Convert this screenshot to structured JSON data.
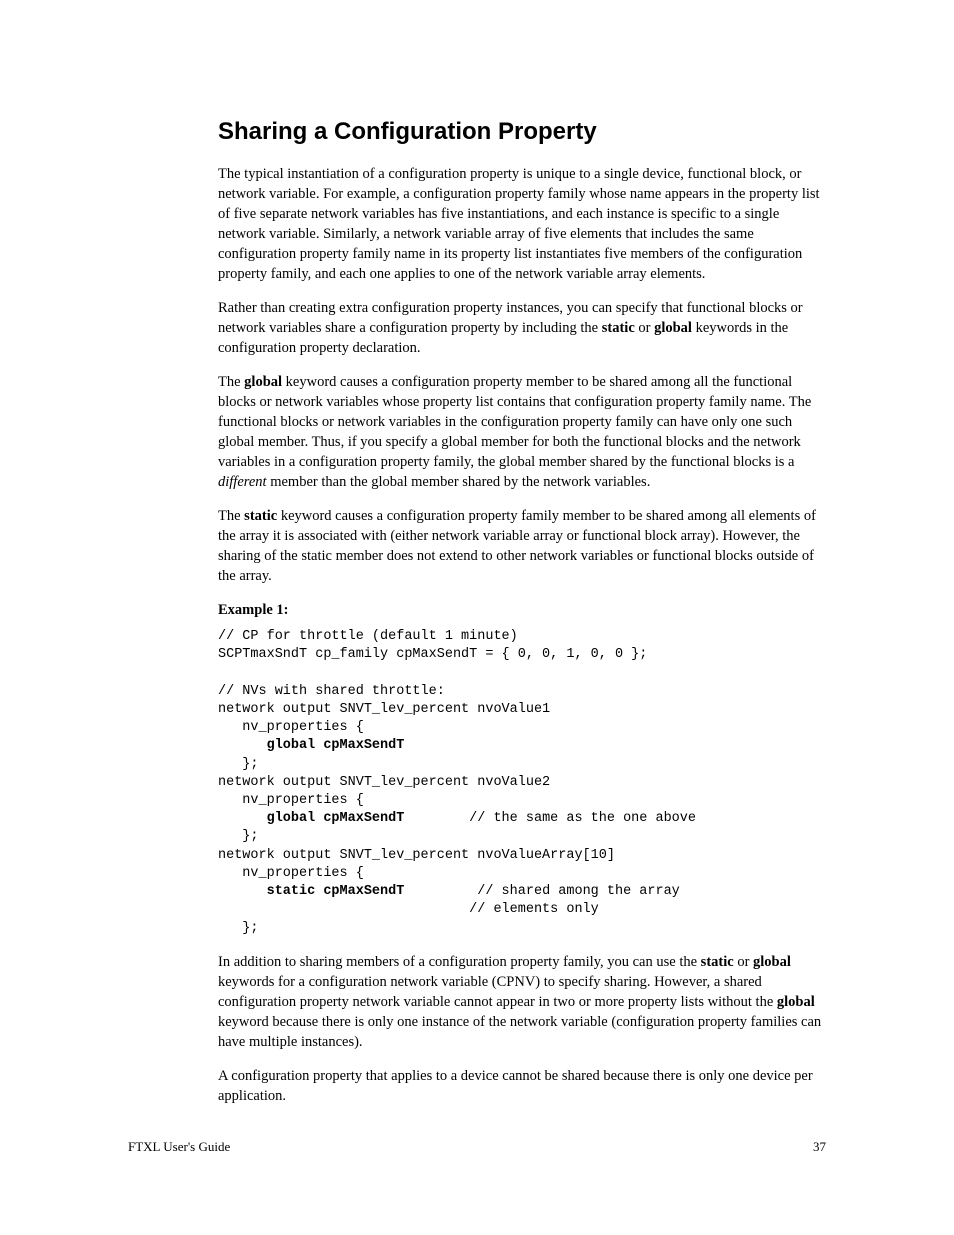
{
  "heading": "Sharing a Configuration Property",
  "para1": "The typical instantiation of a configuration property is unique to a single device, functional block, or network variable.  For example, a configuration property family whose name appears in the property list of five separate network variables has five instantiations, and each instance is specific to a single network variable.  Similarly, a network variable array of five elements that includes the same configuration property family name in its property list instantiates five members of the configuration property family, and each one applies to one of the network variable array elements.",
  "para2_a": "Rather than creating extra configuration property instances, you can specify that functional blocks or network variables share a configuration property by including the ",
  "para2_kw1": "static",
  "para2_b": " or ",
  "para2_kw2": "global",
  "para2_c": " keywords in the configuration property declaration.",
  "para3_a": "The ",
  "para3_kw1": "global",
  "para3_b": " keyword causes a configuration property member to be shared among all the functional blocks or network variables whose property list contains that configuration property family name.  The functional blocks or network variables in the configuration property family can have only one such global member.  Thus, if you specify a global member for both the functional blocks and the network variables in a configuration property family, the global member shared by the functional blocks is a ",
  "para3_italic": "different",
  "para3_c": " member than the global member shared by the network variables.",
  "para4_a": "The ",
  "para4_kw1": "static",
  "para4_b": " keyword causes a configuration property family member to be shared among all elements of the array it is associated with (either network variable array or functional block array).  However, the sharing of the static member does not extend to other network variables or functional blocks outside of the array.",
  "example_label": "Example 1",
  "code": {
    "l1": "// CP for throttle (default 1 minute)",
    "l2": "SCPTmaxSndT cp_family cpMaxSendT = { 0, 0, 1, 0, 0 };",
    "l3": "",
    "l4": "// NVs with shared throttle:",
    "l5": "network output SNVT_lev_percent nvoValue1",
    "l6": "   nv_properties {",
    "l7a": "      ",
    "l7b": "global cpMaxSendT",
    "l8": "   };",
    "l9": "network output SNVT_lev_percent nvoValue2",
    "l10": "   nv_properties {",
    "l11a": "      ",
    "l11b": "global cpMaxSendT",
    "l11c": "        // the same as the one above",
    "l12": "   };",
    "l13": "network output SNVT_lev_percent nvoValueArray[10]",
    "l14": "   nv_properties {",
    "l15a": "      ",
    "l15b": "static cpMaxSendT",
    "l15c": "         // shared among the array",
    "l16": "                               // elements only",
    "l17": "   };"
  },
  "para5_a": "In addition to sharing members of a configuration property family, you can use the ",
  "para5_kw1": "static",
  "para5_b": " or ",
  "para5_kw2": "global",
  "para5_c": " keywords for a configuration network variable (CPNV) to specify sharing.  However, a shared configuration property network variable cannot appear in two or more property lists without the ",
  "para5_kw3": "global",
  "para5_d": " keyword because there is only one instance of the network variable (configuration property families can have multiple instances).",
  "para6": "A configuration property that applies to a device cannot be shared because there is only one device per application.",
  "footer_left": "FTXL User's Guide",
  "footer_right": "37"
}
